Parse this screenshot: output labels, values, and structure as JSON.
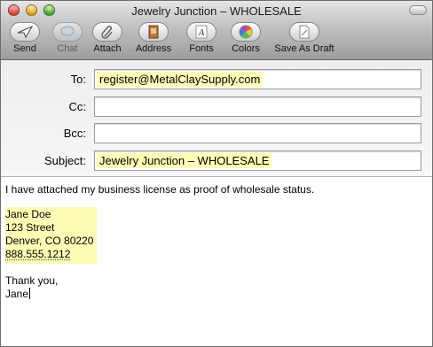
{
  "window": {
    "title": "Jewelry Junction – WHOLESALE"
  },
  "toolbar": {
    "send": "Send",
    "chat": "Chat",
    "attach": "Attach",
    "address": "Address",
    "fonts": "Fonts",
    "colors": "Colors",
    "save_draft": "Save As Draft"
  },
  "fields": {
    "to_label": "To:",
    "to_value": "register@MetalClaySupply.com",
    "cc_label": "Cc:",
    "cc_value": "",
    "bcc_label": "Bcc:",
    "bcc_value": "",
    "subject_label": "Subject:",
    "subject_value": "Jewelry Junction – WHOLESALE"
  },
  "message": {
    "line1": "I have attached my business license as proof of wholesale status.",
    "sig_name": "Jane Doe",
    "sig_street": "123 Street",
    "sig_city": "Denver, CO 80220",
    "sig_phone": "888.555.1212",
    "closing": "Thank you,",
    "signoff": "Jane"
  },
  "colors": {
    "highlight": "#fffcb6",
    "window_border": "#6e6e6e"
  }
}
